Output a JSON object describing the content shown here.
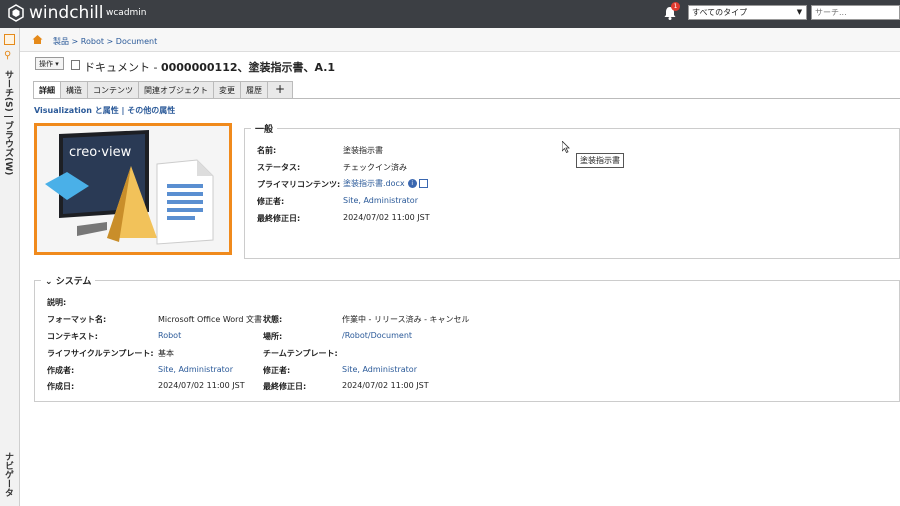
{
  "header": {
    "brand": "windchill",
    "user": "wcadmin",
    "notification_count": "1",
    "type_select": "すべてのタイプ",
    "search_placeholder": "サーチ..."
  },
  "leftrail": {
    "search_label": "サーチ(S) | ブラウズ(W)",
    "navigator_label": "ナビゲータ"
  },
  "breadcrumb": "製品 > Robot > Document",
  "toolbar": {
    "actions_label": "操作 ▾",
    "title_prefix": "ドキュメント - ",
    "title_bold": "0000000112、塗装指示書、A.1"
  },
  "tabs": [
    "詳細",
    "構造",
    "コンテンツ",
    "関連オブジェクト",
    "変更",
    "履歴",
    "+"
  ],
  "subnav": "Visualization と属性 | その他の属性",
  "preview": {
    "logo_text": "creo·view"
  },
  "general": {
    "title": "一般",
    "rows": [
      {
        "label": "名前:",
        "value": "塗装指示書"
      },
      {
        "label": "ステータス:",
        "value": "チェックイン済み"
      },
      {
        "label": "プライマリコンテンツ:",
        "value": "塗装指示書.docx"
      },
      {
        "label": "修正者:",
        "value": "Site, Administrator"
      },
      {
        "label": "最終修正日:",
        "value": "2024/07/02 11:00 JST"
      }
    ]
  },
  "tooltip": "塗装指示書",
  "system": {
    "title": "システム",
    "description_label": "説明:",
    "left": [
      {
        "label": "フォーマット名:",
        "value": "Microsoft Office Word 文書"
      },
      {
        "label": "コンテキスト:",
        "value": "Robot"
      },
      {
        "label": "ライフサイクルテンプレート:",
        "value": "基本"
      },
      {
        "label": "作成者:",
        "value": "Site, Administrator"
      },
      {
        "label": "作成日:",
        "value": "2024/07/02 11:00 JST"
      }
    ],
    "right": [
      {
        "label": "状態:",
        "value": "作業中 - リリース済み - キャンセル"
      },
      {
        "label": "場所:",
        "value": "/Robot/Document"
      },
      {
        "label": "チームテンプレート:",
        "value": ""
      },
      {
        "label": "修正者:",
        "value": "Site, Administrator"
      },
      {
        "label": "最終修正日:",
        "value": "2024/07/02 11:00 JST"
      }
    ]
  },
  "colors": {
    "topbar": "#3c3f44",
    "accent": "#f08a1c",
    "link": "#2b5a99"
  }
}
